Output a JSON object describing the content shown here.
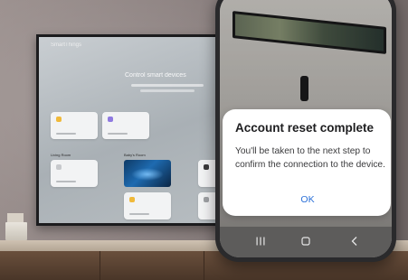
{
  "tv": {
    "brand": "SmartThings",
    "headline": "Control smart devices",
    "rooms": [
      "Living Room",
      "Baby's Room"
    ]
  },
  "dialog": {
    "title": "Account reset complete",
    "message": "You'll be taken to the next step to confirm the connection to the device.",
    "ok_label": "OK"
  },
  "navbar": {
    "recent_icon": "recent-apps-icon",
    "home_icon": "home-icon",
    "back_icon": "back-icon"
  },
  "colors": {
    "accent": "#2b70d8",
    "dialog_bg": "#ffffff",
    "navbar_bg": "#5d5c5b"
  }
}
